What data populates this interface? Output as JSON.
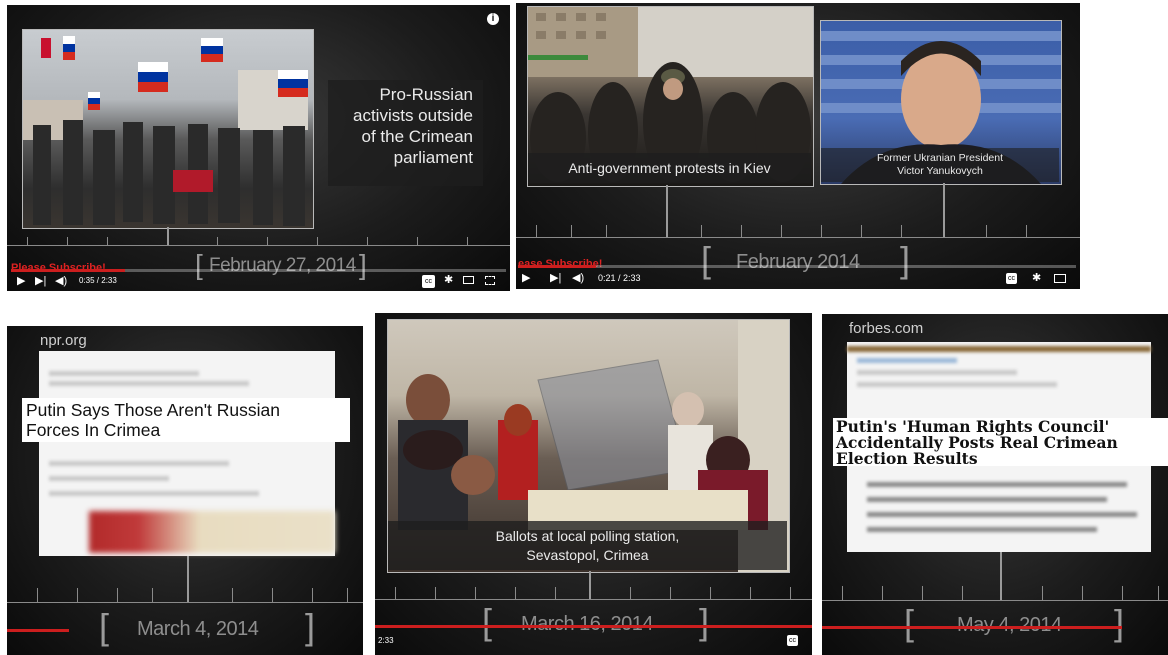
{
  "panels": {
    "p1": {
      "caption": [
        "Pro-Russian",
        "activists outside",
        "of the Crimean",
        "parliament"
      ],
      "date": "February 27, 2014",
      "subscribe": "Please Subscribe!",
      "time": "0:35 / 2:33",
      "icons": [
        "info-icon",
        "play-icon",
        "next-icon",
        "volume-icon",
        "cc-icon",
        "gear-icon",
        "theater-icon",
        "fullscreen-icon"
      ]
    },
    "p2": {
      "caption_left": "Anti-government protests in Kiev",
      "caption_right": [
        "Former Ukranian President",
        "Victor Yanukovych"
      ],
      "date": "February 2014",
      "subscribe": "ease Subscribe!",
      "time": "0:21 / 2:33",
      "icons": [
        "play-icon",
        "next-icon",
        "volume-icon",
        "cc-icon",
        "gear-icon",
        "theater-icon"
      ]
    },
    "p3": {
      "site": "npr.org",
      "headline": [
        "Putin Says Those Aren't Russian",
        "Forces In Crimea"
      ],
      "date": "March 4, 2014"
    },
    "p4": {
      "caption": [
        "Ballots at local polling station,",
        "Sevastopol, Crimea"
      ],
      "date": "March 16, 2014",
      "time": "2:33",
      "icons": [
        "cc-icon"
      ]
    },
    "p5": {
      "site": "forbes.com",
      "headline": [
        "Putin's 'Human Rights Council'",
        "Accidentally Posts Real Crimean",
        "Election Results"
      ],
      "date": "May 4, 2014"
    }
  },
  "colors": {
    "progress": "#cc1e1e",
    "caption_bg": "#1e1e1e",
    "timeline": "#8a8a8a"
  }
}
